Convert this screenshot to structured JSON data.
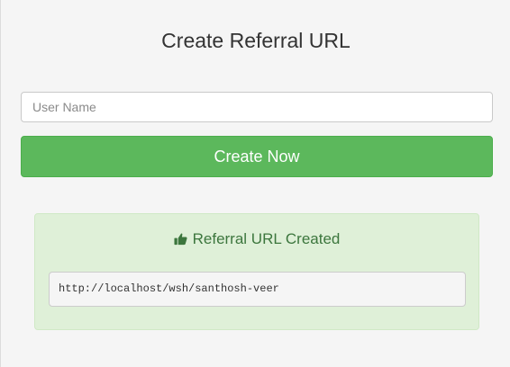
{
  "page": {
    "title": "Create Referral URL"
  },
  "form": {
    "username_placeholder": "User Name",
    "username_value": "",
    "submit_label": "Create Now"
  },
  "result": {
    "heading": "Referral URL Created",
    "icon": "thumbs-up-icon",
    "url": "http://localhost/wsh/santhosh-veer"
  },
  "colors": {
    "primary_button": "#5cb85c",
    "success_background": "#dff0d8",
    "success_text": "#3c763d"
  }
}
